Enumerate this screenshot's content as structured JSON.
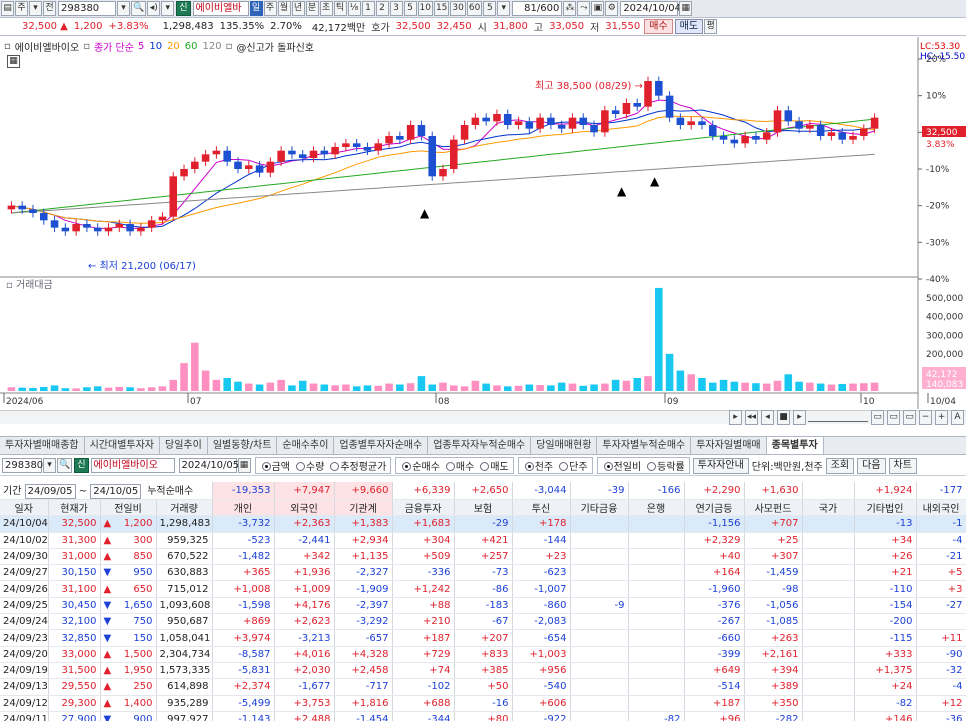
{
  "toolbar1": {
    "mode_label": "주",
    "total_label": "전",
    "code": "298380",
    "credit_badge": "신",
    "stock_name": "에이비엘바",
    "period_buttons": [
      "일",
      "주",
      "월",
      "년",
      "분",
      "초",
      "틱"
    ],
    "period_selected": "일",
    "fraction_label": "⅛",
    "interval_buttons": [
      "1",
      "2",
      "3",
      "5",
      "10",
      "15",
      "30",
      "60",
      "5"
    ],
    "count_display": "81/600",
    "date": "2024/10/04"
  },
  "toolbar2": {
    "price": "32,500",
    "change": "1,200",
    "pct": "+3.83%",
    "volume": "1,298,483",
    "vol_ratio": "135.35%",
    "turnover": "2.70%",
    "amount": "42,172백만",
    "quote_label": "호가",
    "ask": "32,500",
    "bid": "32,450",
    "open_label": "시",
    "open": "31,800",
    "high_label": "고",
    "high": "33,050",
    "low_label": "저",
    "low": "31,550",
    "buy_btn": "매수",
    "sell_btn": "매도",
    "eval_btn": "평"
  },
  "chart": {
    "legend_name": "에이비엘바이오",
    "legend_ma": "종가 단순",
    "ma_periods": [
      "5",
      "10",
      "20",
      "60",
      "120"
    ],
    "legend_signal": "@신고가 돌파신호",
    "high_annotation": "최고 38,500 (08/29)",
    "low_annotation": "최저 21,200 (06/17)",
    "lc_label": "LC:53.30",
    "hc_label": "HC:-15.50",
    "y_ticks": [
      "20%",
      "10%",
      "0%",
      "-10%",
      "-20%",
      "-30%",
      "-40%"
    ],
    "top_tick": "-30%",
    "price_tag": "32,500",
    "pct_tag": "3.83%",
    "volume_title": "거래대금",
    "vol_ticks": [
      "500,000",
      "400,000",
      "300,000",
      "200,000",
      "100,000"
    ],
    "vol_tag1": "42,172",
    "vol_tag2": "140,083",
    "x_labels": [
      "2024/06",
      "07",
      "08",
      "09",
      "10",
      "10/04"
    ]
  },
  "tabs": [
    "투자자별매매종합",
    "시간대별투자자",
    "당일추이",
    "일별동향/차트",
    "순매수추이",
    "업종별투자자순매수",
    "업종투자자누적순매수",
    "당일매매현황",
    "투자자별누적순매수",
    "투자자일별매매",
    "종목별투자"
  ],
  "active_tab": 10,
  "controls": {
    "code": "298380",
    "credit": "신",
    "name": "에이비엘바이오",
    "date": "2024/10/05",
    "group1": [
      "금액",
      "수량",
      "추정평균가"
    ],
    "group2": [
      "순매수",
      "매수",
      "매도"
    ],
    "group3": [
      "천주",
      "단주"
    ],
    "group4": [
      "전일비",
      "등락률"
    ],
    "guide_btn": "투자자안내",
    "unit": "단위:백만원,천주",
    "query_btn": "조회",
    "next_btn": "다음",
    "chart_btn": "차트"
  },
  "summary": {
    "label": "기간",
    "from": "24/09/05",
    "to": "24/10/05",
    "cum_label": "누적순매수",
    "values": [
      "-19,353",
      "+7,947",
      "+9,660",
      "+6,339",
      "+2,650",
      "-3,044",
      "-39",
      "-166",
      "+2,290",
      "+1,630",
      "",
      "+1,924",
      "-177"
    ]
  },
  "table": {
    "headers": [
      "일자",
      "현재가",
      "전일비",
      "거래량",
      "개인",
      "외국인",
      "기관계",
      "금융투자",
      "보험",
      "투신",
      "기타금융",
      "은행",
      "연기금등",
      "사모펀드",
      "국가",
      "기타법인",
      "내외국인"
    ],
    "rows": [
      [
        "24/10/04",
        "32,500",
        "▲",
        "1,200",
        "1,298,483",
        "-3,732",
        "+2,363",
        "+1,383",
        "+1,683",
        "-29",
        "+178",
        "",
        "",
        "-1,156",
        "+707",
        "",
        "-13",
        "-1"
      ],
      [
        "24/10/02",
        "31,300",
        "▲",
        "300",
        "959,325",
        "-523",
        "-2,441",
        "+2,934",
        "+304",
        "+421",
        "-144",
        "",
        "",
        "+2,329",
        "+25",
        "",
        "+34",
        "-4"
      ],
      [
        "24/09/30",
        "31,000",
        "▲",
        "850",
        "670,522",
        "-1,482",
        "+342",
        "+1,135",
        "+509",
        "+257",
        "+23",
        "",
        "",
        "+40",
        "+307",
        "",
        "+26",
        "-21"
      ],
      [
        "24/09/27",
        "30,150",
        "▼",
        "950",
        "630,883",
        "+365",
        "+1,936",
        "-2,327",
        "-336",
        "-73",
        "-623",
        "",
        "",
        "+164",
        "-1,459",
        "",
        "+21",
        "+5"
      ],
      [
        "24/09/26",
        "31,100",
        "▲",
        "650",
        "715,012",
        "+1,008",
        "+1,009",
        "-1,909",
        "+1,242",
        "-86",
        "-1,007",
        "",
        "",
        "-1,960",
        "-98",
        "",
        "-110",
        "+3"
      ],
      [
        "24/09/25",
        "30,450",
        "▼",
        "1,650",
        "1,093,608",
        "-1,598",
        "+4,176",
        "-2,397",
        "+88",
        "-183",
        "-860",
        "-9",
        "",
        "-376",
        "-1,056",
        "",
        "-154",
        "-27"
      ],
      [
        "24/09/24",
        "32,100",
        "▼",
        "750",
        "950,687",
        "+869",
        "+2,623",
        "-3,292",
        "+210",
        "-67",
        "-2,083",
        "",
        "",
        "-267",
        "-1,085",
        "",
        "-200",
        ""
      ],
      [
        "24/09/23",
        "32,850",
        "▼",
        "150",
        "1,058,041",
        "+3,974",
        "-3,213",
        "-657",
        "+187",
        "+207",
        "-654",
        "",
        "",
        "-660",
        "+263",
        "",
        "-115",
        "+11"
      ],
      [
        "24/09/20",
        "33,000",
        "▲",
        "1,500",
        "2,304,734",
        "-8,587",
        "+4,016",
        "+4,328",
        "+729",
        "+833",
        "+1,003",
        "",
        "",
        "-399",
        "+2,161",
        "",
        "+333",
        "-90"
      ],
      [
        "24/09/19",
        "31,500",
        "▲",
        "1,950",
        "1,573,335",
        "-5,831",
        "+2,030",
        "+2,458",
        "+74",
        "+385",
        "+956",
        "",
        "",
        "+649",
        "+394",
        "",
        "+1,375",
        "-32"
      ],
      [
        "24/09/13",
        "29,550",
        "▲",
        "250",
        "614,898",
        "+2,374",
        "-1,677",
        "-717",
        "-102",
        "+50",
        "-540",
        "",
        "",
        "-514",
        "+389",
        "",
        "+24",
        "-4"
      ],
      [
        "24/09/12",
        "29,300",
        "▲",
        "1,400",
        "935,289",
        "-5,499",
        "+3,753",
        "+1,816",
        "+688",
        "-16",
        "+606",
        "",
        "",
        "+187",
        "+350",
        "",
        "-82",
        "+12"
      ],
      [
        "24/09/11",
        "27,900",
        "▼",
        "900",
        "997,927",
        "-1,143",
        "+2,488",
        "-1,454",
        "-344",
        "+80",
        "-922",
        "",
        "-82",
        "+96",
        "-282",
        "",
        "+146",
        "-36"
      ]
    ]
  },
  "chart_data": {
    "type": "candlestick",
    "period": "daily",
    "x_range": [
      "2024/06",
      "10/04"
    ],
    "y_axis": "percent",
    "ylim": [
      -40,
      20
    ],
    "last_price": 32500,
    "high": {
      "value": 38500,
      "date": "08/29"
    },
    "low": {
      "value": 21200,
      "date": "06/17"
    },
    "close_pct": [
      -20,
      -21,
      -22,
      -24,
      -26,
      -27,
      -25,
      -26,
      -27,
      -26,
      -25,
      -27,
      -26,
      -24,
      -23,
      -12,
      -10,
      -8,
      -6,
      -5,
      -8,
      -10,
      -9,
      -11,
      -8,
      -5,
      -6,
      -7,
      -5,
      -6,
      -4,
      -3,
      -4,
      -5,
      -3,
      -1,
      -2,
      2,
      -1,
      -12,
      -10,
      -2,
      2,
      4,
      3,
      5,
      2,
      3,
      1,
      4,
      2,
      1,
      4,
      2,
      0,
      6,
      5,
      8,
      7,
      14,
      10,
      4,
      2,
      3,
      2,
      -1,
      -2,
      -3,
      -1,
      -2,
      0,
      6,
      3,
      1,
      2,
      -1,
      0,
      -2,
      -1,
      1,
      4
    ],
    "volume_amount": [
      20,
      18,
      16,
      22,
      30,
      15,
      14,
      20,
      25,
      18,
      22,
      20,
      15,
      20,
      25,
      60,
      150,
      260,
      110,
      60,
      70,
      50,
      40,
      35,
      45,
      60,
      30,
      55,
      40,
      35,
      30,
      35,
      25,
      30,
      28,
      40,
      35,
      42,
      80,
      35,
      45,
      30,
      25,
      55,
      40,
      30,
      25,
      28,
      35,
      32,
      30,
      45,
      40,
      28,
      35,
      40,
      60,
      55,
      70,
      80,
      555,
      200,
      110,
      90,
      70,
      45,
      60,
      50,
      45,
      42,
      40,
      55,
      90,
      50,
      45,
      40,
      35,
      38,
      40,
      42,
      45
    ],
    "ma_series": [
      {
        "name": "5",
        "color": "#cc00cc"
      },
      {
        "name": "10",
        "color": "#0033cc"
      },
      {
        "name": "20",
        "color": "#ff9900"
      },
      {
        "name": "60",
        "color": "#22aa22"
      },
      {
        "name": "120",
        "color": "#888888"
      }
    ]
  }
}
